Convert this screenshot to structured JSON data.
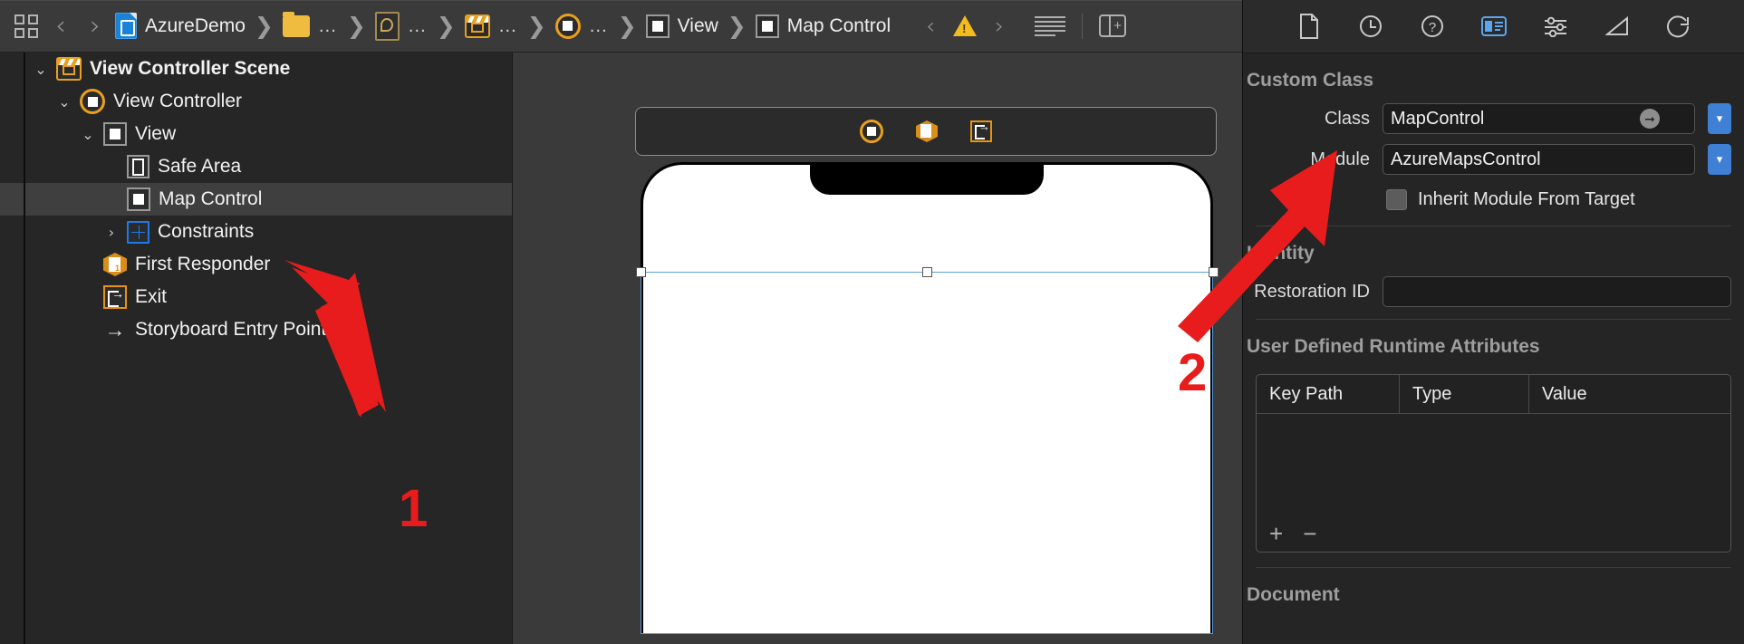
{
  "jumpbar": {
    "grid_icon": "grid-icon",
    "back_label": "‹",
    "forward_label": "›",
    "separator": "❯",
    "dots": "…",
    "crumbs": [
      {
        "icon": "storyboard-file-icon",
        "label": "AzureDemo"
      },
      {
        "icon": "folder-icon",
        "label": "…"
      },
      {
        "icon": "file-icon",
        "label": "…"
      },
      {
        "icon": "scene-icon",
        "label": "…"
      },
      {
        "icon": "view-controller-icon",
        "label": "…"
      },
      {
        "icon": "view-icon",
        "label": "View"
      },
      {
        "icon": "view-icon",
        "label": "Map Control"
      }
    ],
    "issue_prev": "‹",
    "issue_icon": "warning-triangle-icon",
    "issue_next": "›",
    "minimap_icon": "document-items-icon",
    "assistant_icon": "add-editor-icon"
  },
  "navigator": {
    "rows": [
      {
        "label": "View Controller Scene",
        "icon": "scene-icon",
        "disclosure": "⌄",
        "indent": 0,
        "selected": false,
        "bold": true
      },
      {
        "label": "View Controller",
        "icon": "view-controller-icon",
        "disclosure": "⌄",
        "indent": 1,
        "selected": false,
        "bold": false
      },
      {
        "label": "View",
        "icon": "view-icon",
        "disclosure": "⌄",
        "indent": 2,
        "selected": false,
        "bold": false
      },
      {
        "label": "Safe Area",
        "icon": "safe-area-icon",
        "disclosure": "",
        "indent": 3,
        "selected": false,
        "bold": false
      },
      {
        "label": "Map Control",
        "icon": "view-icon",
        "disclosure": "",
        "indent": 3,
        "selected": true,
        "bold": false
      },
      {
        "label": "Constraints",
        "icon": "constraints-icon",
        "disclosure": "›",
        "indent": 2,
        "selected": false,
        "bold": false
      },
      {
        "label": "First Responder",
        "icon": "first-responder-icon",
        "disclosure": "",
        "indent": 1,
        "selected": false,
        "bold": false
      },
      {
        "label": "Exit",
        "icon": "exit-icon",
        "disclosure": "",
        "indent": 1,
        "selected": false,
        "bold": false
      },
      {
        "label": "Storyboard Entry Point",
        "icon": "entry-point-arrow-icon",
        "disclosure": "",
        "indent": 1,
        "selected": false,
        "bold": false
      }
    ]
  },
  "canvas": {
    "dock": [
      {
        "icon": "view-controller-icon",
        "name": "scene-dock-view-controller"
      },
      {
        "icon": "first-responder-icon",
        "name": "scene-dock-first-responder"
      },
      {
        "icon": "exit-icon",
        "name": "scene-dock-exit"
      }
    ]
  },
  "inspector": {
    "tabs": [
      {
        "icon": "file-inspector-icon",
        "name": "tab-file-inspector",
        "active": false
      },
      {
        "icon": "history-inspector-icon",
        "name": "tab-history-inspector",
        "active": false
      },
      {
        "icon": "help-inspector-icon",
        "name": "tab-quick-help",
        "active": false
      },
      {
        "icon": "identity-inspector-icon",
        "name": "tab-identity-inspector",
        "active": true
      },
      {
        "icon": "attributes-inspector-icon",
        "name": "tab-attributes-inspector",
        "active": false
      },
      {
        "icon": "size-inspector-icon",
        "name": "tab-size-inspector",
        "active": false
      },
      {
        "icon": "connections-inspector-icon",
        "name": "tab-connections-inspector",
        "active": false
      }
    ],
    "custom_class": {
      "title": "Custom Class",
      "class_label": "Class",
      "class_value": "MapControl",
      "module_label": "Module",
      "module_value": "AzureMapsControl",
      "inherit_label": "Inherit Module From Target",
      "inherit_checked": false
    },
    "identity": {
      "title": "Identity",
      "restoration_label": "Restoration ID",
      "restoration_value": ""
    },
    "runtime": {
      "title": "User Defined Runtime Attributes",
      "columns": [
        "Key Path",
        "Type",
        "Value"
      ],
      "rows": [],
      "add_label": "+",
      "remove_label": "−"
    },
    "document": {
      "title": "Document"
    }
  },
  "annotations": [
    {
      "label": "1",
      "target": "map-control-row"
    },
    {
      "label": "2",
      "target": "module-field"
    }
  ],
  "colors": {
    "accent_orange": "#e8a020",
    "selection_blue": "#5aa7f0",
    "annotation_red": "#e81c1c",
    "warning_yellow": "#f4bb1e"
  }
}
